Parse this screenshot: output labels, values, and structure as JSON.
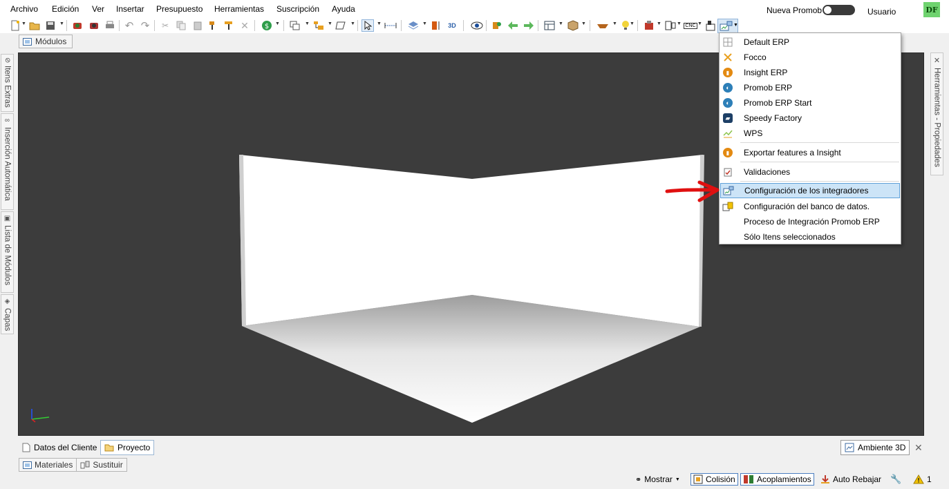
{
  "menubar": {
    "items": [
      "Archivo",
      "Edición",
      "Ver",
      "Insertar",
      "Presupuesto",
      "Herramientas",
      "Suscripción",
      "Ayuda"
    ],
    "nueva_promob": "Nueva Promob",
    "usuario": "Usuario",
    "avatar": "DF"
  },
  "toolbar": {
    "icons": [
      "new-file-icon",
      "open-folder-icon",
      "save-icon",
      "render-icon",
      "render-settings-icon",
      "print-icon",
      "undo-icon",
      "redo-icon",
      "cut-icon",
      "copy-icon",
      "paste-icon",
      "paint-brush-icon",
      "paint-roller-icon",
      "delete-icon",
      "budget-icon",
      "view-icon",
      "layout-icon",
      "shape-icon",
      "select-icon",
      "measure-icon",
      "layers-icon",
      "height-icon",
      "3d-icon",
      "eye-icon",
      "modules-icon",
      "arrow-left-icon",
      "arrow-right-icon",
      "frame-icon",
      "box-icon",
      "lamp-icon",
      "bulb-icon",
      "cnc-icon",
      "tools-icon",
      "integrators-icon"
    ],
    "badges": {
      "3d": "3D",
      "cnc": "CNC"
    }
  },
  "tabs_top": {
    "modulos": "Módulos"
  },
  "left_dock": [
    {
      "label": "Itens Extras",
      "icon": "paperclip-icon"
    },
    {
      "label": "Inserción Automática",
      "icon": "link-icon"
    },
    {
      "label": "Lista de Módulos",
      "icon": "list-icon"
    },
    {
      "label": "Capas",
      "icon": "layers-icon"
    }
  ],
  "right_dock": {
    "label": "Herramientas - Propiedades",
    "icon": "wrench-icon"
  },
  "bottom_tabs": {
    "datos_cliente": "Datos del Cliente",
    "proyecto": "Proyecto",
    "ambiente": "Ambiente 3D"
  },
  "lower_tabs": {
    "materiales": "Materiales",
    "sustituir": "Sustituir"
  },
  "statusbar": {
    "mostrar": "Mostrar",
    "colision": "Colisión",
    "acoplamientos": "Acoplamientos",
    "auto_rebajar": "Auto Rebajar",
    "warnings": "1"
  },
  "dropdown": {
    "items": [
      {
        "label": "Default ERP",
        "icon": "grid-icon"
      },
      {
        "label": "Focco",
        "icon": "focco-icon"
      },
      {
        "label": "Insight ERP",
        "icon": "insight-icon"
      },
      {
        "label": "Promob ERP",
        "icon": "promob-erp-icon"
      },
      {
        "label": "Promob ERP Start",
        "icon": "promob-erp-start-icon"
      },
      {
        "label": "Speedy Factory",
        "icon": "speedy-factory-icon"
      },
      {
        "label": "WPS",
        "icon": "wps-icon"
      },
      {
        "label": "Exportar features a Insight",
        "icon": "insight-icon"
      },
      {
        "label": "Validaciones",
        "icon": "clipboard-check-icon"
      },
      {
        "label": "Configuración de los integradores",
        "icon": "integrators-config-icon"
      },
      {
        "label": "Configuración del banco de datos.",
        "icon": "database-config-icon"
      },
      {
        "label": "Proceso de Integración Promob ERP",
        "icon": ""
      },
      {
        "label": "Sólo Itens seleccionados",
        "icon": ""
      }
    ],
    "highlighted_index": 9
  },
  "colors": {
    "accent": "#cce4f7",
    "viewport": "#3c3c3c",
    "annotation_arrow": "#e01010"
  }
}
